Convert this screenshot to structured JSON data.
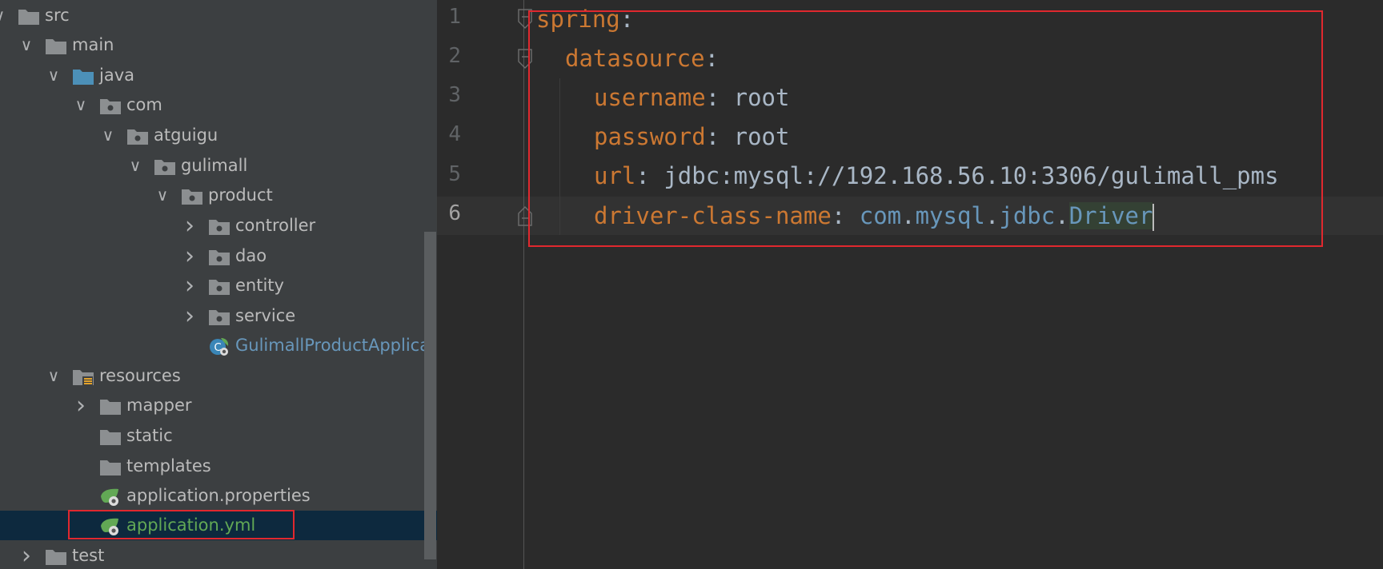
{
  "tree": {
    "items": [
      {
        "label": "src",
        "kind": "folder",
        "expanded": true
      },
      {
        "label": "main",
        "kind": "folder",
        "expanded": true
      },
      {
        "label": "java",
        "kind": "source-folder",
        "expanded": true
      },
      {
        "label": "com",
        "kind": "package",
        "expanded": true
      },
      {
        "label": "atguigu",
        "kind": "package",
        "expanded": true
      },
      {
        "label": "gulimall",
        "kind": "package",
        "expanded": true
      },
      {
        "label": "product",
        "kind": "package",
        "expanded": true
      },
      {
        "label": "controller",
        "kind": "package",
        "expanded": false
      },
      {
        "label": "dao",
        "kind": "package",
        "expanded": false
      },
      {
        "label": "entity",
        "kind": "package",
        "expanded": false
      },
      {
        "label": "service",
        "kind": "package",
        "expanded": false
      },
      {
        "label": "GulimallProductApplicat",
        "kind": "spring-class"
      },
      {
        "label": "resources",
        "kind": "resources-folder",
        "expanded": true
      },
      {
        "label": "mapper",
        "kind": "folder",
        "expanded": false
      },
      {
        "label": "static",
        "kind": "folder"
      },
      {
        "label": "templates",
        "kind": "folder"
      },
      {
        "label": "application.properties",
        "kind": "spring-config"
      },
      {
        "label": "application.yml",
        "kind": "spring-config",
        "selected": true
      },
      {
        "label": "test",
        "kind": "folder",
        "expanded": false
      }
    ]
  },
  "editor": {
    "line_numbers": [
      "1",
      "2",
      "3",
      "4",
      "5",
      "6"
    ],
    "current_line": "6",
    "lines": {
      "l1": {
        "key": "spring",
        "sep": ":"
      },
      "l2": {
        "key": "datasource",
        "sep": ":"
      },
      "l3": {
        "key": "username",
        "sep": ": ",
        "value": "root"
      },
      "l4": {
        "key": "password",
        "sep": ": ",
        "value": "root"
      },
      "l5": {
        "key": "url",
        "sep": ": ",
        "value": "jdbc:mysql://192.168.56.10:3306/gulimall_pms"
      },
      "l6": {
        "key": "driver-class-name",
        "sep": ": ",
        "pkg1": "com",
        "dot1": ".",
        "pkg2": "mysql",
        "dot2": ".",
        "pkg3": "jdbc",
        "dot3": ".",
        "cls": "Driver"
      }
    }
  },
  "colors": {
    "highlight_box": "#e0282e",
    "yaml_key": "#cc7832",
    "selection_bg": "#0d293e"
  }
}
